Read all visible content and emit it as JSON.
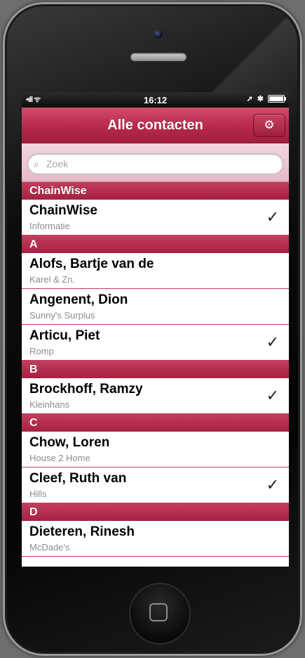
{
  "statusbar": {
    "signal": "•ıll",
    "wifi": "ᯤ",
    "time": "16:12",
    "location": "➚",
    "bluetooth": "✱"
  },
  "navbar": {
    "title": "Alle contacten",
    "settings_icon": "gear-icon",
    "settings_glyph": "⚙"
  },
  "search": {
    "placeholder": "Zoek",
    "icon_glyph": "⌕"
  },
  "accent_color": "#b8284a",
  "sections": [
    {
      "title": "ChainWise",
      "rows": [
        {
          "name": "ChainWise",
          "sub": "Informatie",
          "check": "✓"
        }
      ]
    },
    {
      "title": "A",
      "rows": [
        {
          "name": "Alofs, Bartje van de",
          "sub": "Karel & Zn.",
          "check": ""
        },
        {
          "name": "Angenent, Dion",
          "sub": "Sunny's Surplus",
          "check": ""
        },
        {
          "name": "Articu, Piet",
          "sub": "Romp",
          "check": "✓"
        }
      ]
    },
    {
      "title": "B",
      "rows": [
        {
          "name": "Brockhoff, Ramzy",
          "sub": "Kleinhans",
          "check": "✓"
        }
      ]
    },
    {
      "title": "C",
      "rows": [
        {
          "name": "Chow, Loren",
          "sub": "House 2 Home",
          "check": ""
        },
        {
          "name": "Cleef, Ruth van",
          "sub": "Hills",
          "check": "✓"
        }
      ]
    },
    {
      "title": "D",
      "rows": [
        {
          "name": "Dieteren, Rinesh",
          "sub": "McDade's",
          "check": ""
        }
      ]
    }
  ]
}
